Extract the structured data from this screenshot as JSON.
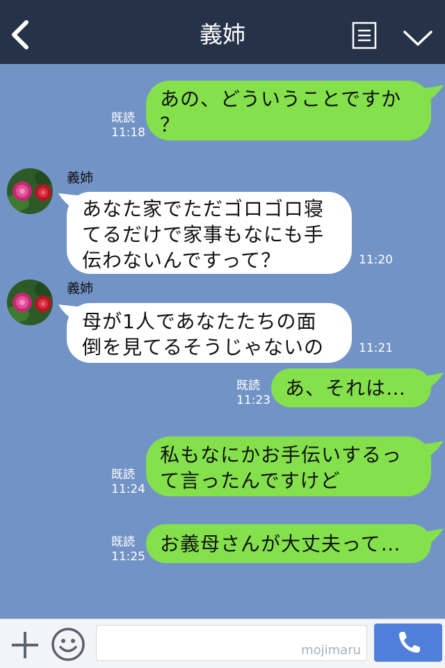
{
  "header": {
    "title": "義姉"
  },
  "messages": [
    {
      "read": "既読",
      "time": "11:18",
      "text": "あの、どういうことですか\n？"
    },
    {
      "sender": "義姉",
      "time": "11:20",
      "text": "あなた家でただゴロゴロ寝\nてるだけで家事もなにも手\n伝わないんですって？"
    },
    {
      "sender": "義姉",
      "time": "11:21",
      "text": "母が1人であなたたちの面\n倒を見てるそうじゃないの"
    },
    {
      "read": "既読",
      "time": "11:23",
      "text": "あ、それは…"
    },
    {
      "read": "既読",
      "time": "11:24",
      "text": "私もなにかお手伝いするっ\nて言ったんですけど"
    },
    {
      "read": "既読",
      "time": "11:25",
      "text": "お義母さんが大丈夫って…"
    }
  ],
  "footer": {
    "watermark": "mojimaru"
  },
  "colors": {
    "header": "#263248",
    "chat_bg": "#7293c6",
    "my_bubble": "#84e14c",
    "their_bubble": "#ffffff",
    "send_button": "#4f7fd9"
  },
  "icons": {
    "back": "chevron-left-icon",
    "menu": "menu-list-icon",
    "collapse": "chevron-down-icon",
    "plus": "plus-icon",
    "emoji": "smiley-icon",
    "call": "phone-icon"
  }
}
